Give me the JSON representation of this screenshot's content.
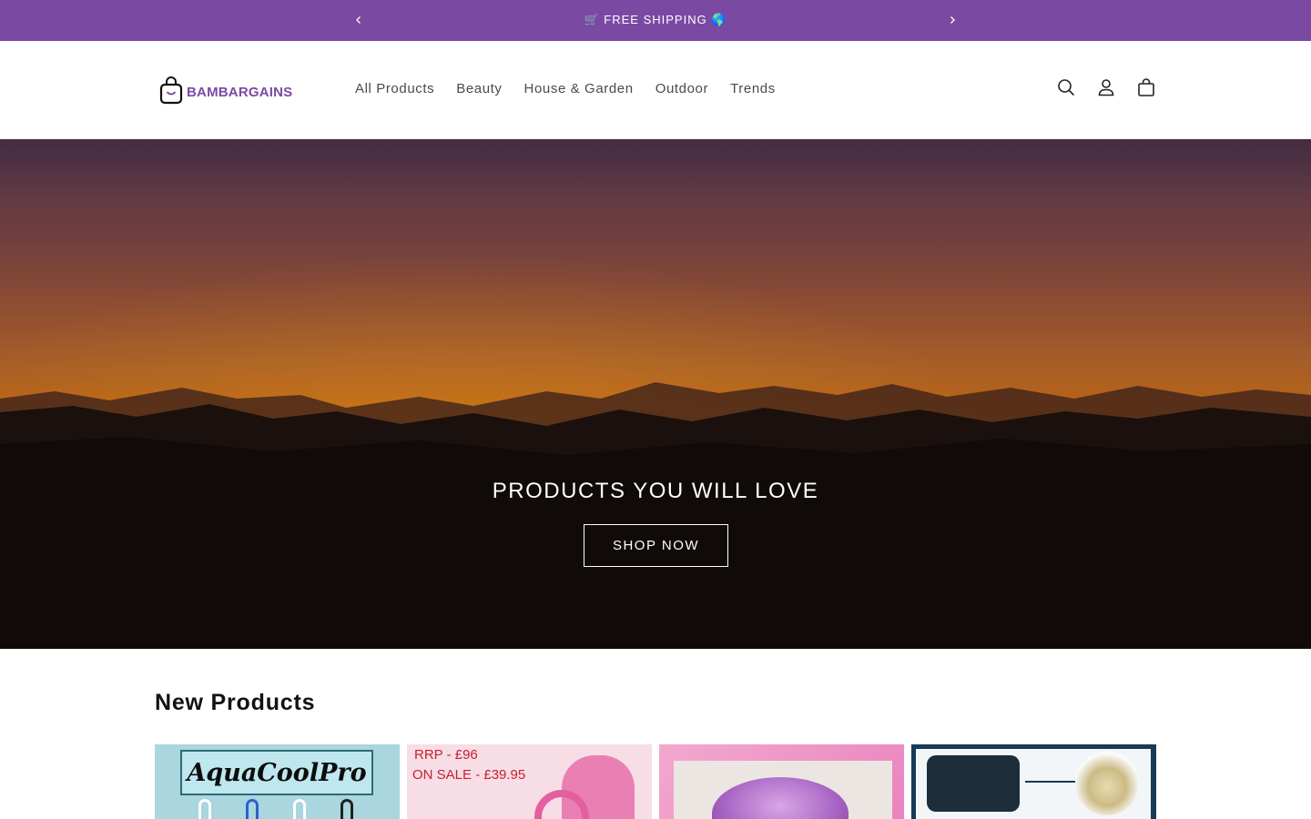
{
  "announcement": {
    "message": "🛒 FREE SHIPPING 🌎",
    "prev_icon": "chevron-left-icon",
    "next_icon": "chevron-right-icon",
    "background": "#7a4aa3"
  },
  "header": {
    "logo_text": "BAMBARGAINS",
    "nav": [
      "All Products",
      "Beauty",
      "House & Garden",
      "Outdoor",
      "Trends"
    ],
    "icons": [
      "search-icon",
      "account-icon",
      "cart-icon"
    ]
  },
  "hero": {
    "title": "PRODUCTS YOU WILL LOVE",
    "button": "SHOP NOW"
  },
  "new_products": {
    "title": "New Products",
    "cards": [
      {
        "text": "AquaCoolPro"
      },
      {
        "line1": "RRP - £96",
        "line2": "ON SALE - £39.95"
      },
      {},
      {}
    ]
  },
  "colors": {
    "brand": "#7a4aa3",
    "text": "#121212"
  }
}
